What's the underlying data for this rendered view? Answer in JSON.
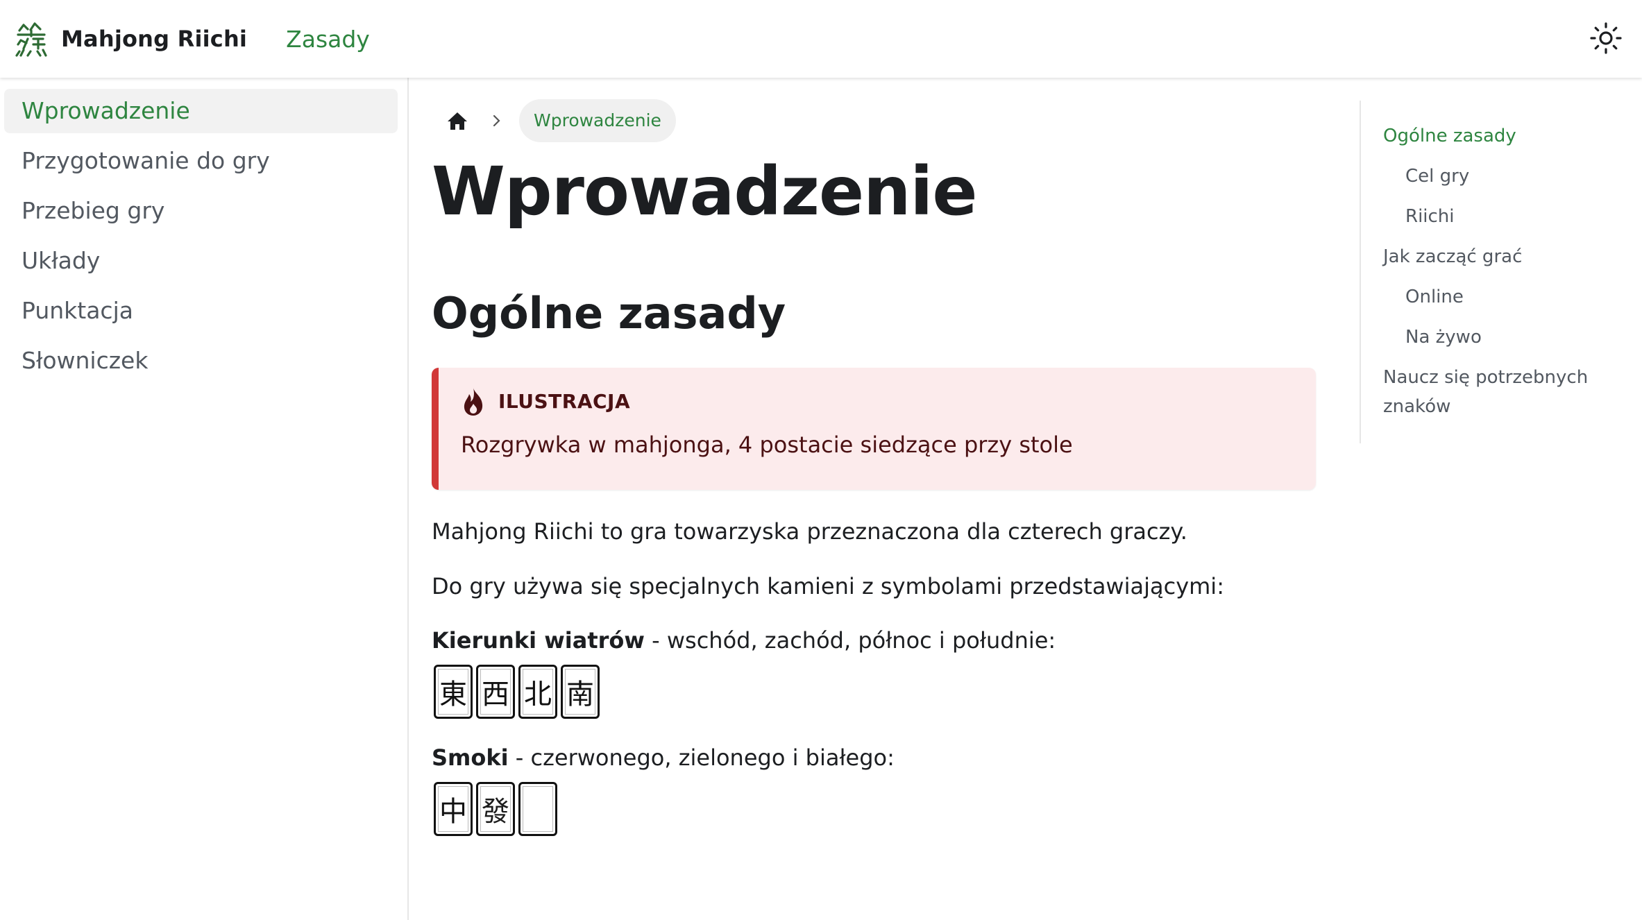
{
  "navbar": {
    "logo_glyph": "🀅",
    "brand_title": "Mahjong Riichi",
    "nav_link": "Zasady",
    "theme_icon": "sun-icon"
  },
  "sidebar": {
    "items": [
      {
        "label": "Wprowadzenie",
        "active": true
      },
      {
        "label": "Przygotowanie do gry"
      },
      {
        "label": "Przebieg gry"
      },
      {
        "label": "Układy"
      },
      {
        "label": "Punktacja"
      },
      {
        "label": "Słowniczek"
      }
    ]
  },
  "breadcrumb": {
    "home_icon": "home-icon",
    "separator_icon": "chevron-right-icon",
    "current": "Wprowadzenie"
  },
  "main": {
    "title": "Wprowadzenie",
    "section_title": "Ogólne zasady",
    "admonition": {
      "icon": "fire-icon",
      "title": "ILUSTRACJA",
      "body": "Rozgrywka w mahjonga, 4 postacie siedzące przy stole",
      "accent_color": "#d13838",
      "background_color": "#fcebec"
    },
    "paragraph1": "Mahjong Riichi to gra towarzyska przeznaczona dla czterech graczy.",
    "paragraph2": "Do gry używa się specjalnych kamieni z symbolami przedstawiającymi:",
    "winds": {
      "label_bold": "Kierunki wiatrów",
      "label_rest": " - wschód, zachód, północ i południe:",
      "tiles": [
        "東",
        "西",
        "北",
        "南"
      ]
    },
    "dragons": {
      "label_bold": "Smoki",
      "label_rest": " - czerwonego, zielonego i białego:",
      "tiles": [
        "中",
        "發",
        ""
      ]
    }
  },
  "toc": {
    "items": [
      {
        "label": "Ogólne zasady",
        "level": 1,
        "active": true
      },
      {
        "label": "Cel gry",
        "level": 2
      },
      {
        "label": "Riichi",
        "level": 2
      },
      {
        "label": "Jak zacząć grać",
        "level": 1
      },
      {
        "label": "Online",
        "level": 2
      },
      {
        "label": "Na żywo",
        "level": 2
      },
      {
        "label": "Naucz się potrzebnych znaków",
        "level": 1
      }
    ]
  },
  "colors": {
    "accent_green": "#2e8540",
    "text_dark": "#1c1e21",
    "text_muted": "#525860"
  }
}
